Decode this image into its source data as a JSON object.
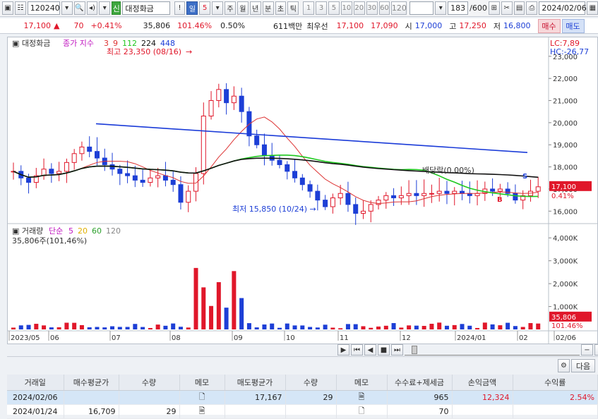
{
  "toolbar": {
    "code": "120240",
    "name_badge": "신",
    "name": "대정화금",
    "bang": "!",
    "period_tabs": [
      "일",
      "5",
      "주",
      "월",
      "년",
      "분",
      "초",
      "틱"
    ],
    "minute_tabs": [
      "1",
      "3",
      "5",
      "10",
      "20",
      "30",
      "60",
      "120"
    ],
    "count": "183",
    "count_total": "/600",
    "date": "2024/02/06"
  },
  "quote": {
    "price": "17,100",
    "change": "70",
    "change_pct": "+0.41%",
    "volume": "35,806",
    "volume_ratio": "101.46%",
    "turnover_rate": "0.50%",
    "amount": "611백만",
    "best_label": "최우선",
    "ask": "17,100",
    "bid": "17,090",
    "open_label": "시",
    "open": "17,000",
    "high_label": "고",
    "high": "17,250",
    "low_label": "저",
    "low": "16,800",
    "buy_btn": "매수",
    "sell_btn": "매도"
  },
  "price_panel": {
    "name": "대정화금",
    "legend_label": "종가 지수",
    "ma": [
      {
        "label": "3",
        "color": "#d33"
      },
      {
        "label": "9",
        "color": "#d33"
      },
      {
        "label": "112",
        "color": "#1fc81f"
      },
      {
        "label": "224",
        "color": "#111"
      },
      {
        "label": "448",
        "color": "#1a3bd8"
      }
    ],
    "lc": "LC:7,89",
    "hc": "HC:-26,77",
    "high_note": "최고 23,350 (08/16)",
    "low_note": "최저 15,850 (10/24)",
    "dividend_note": "배당락(0.00%)",
    "current_tag": "17,100",
    "current_pct": "0.41%",
    "marker_s": "S",
    "marker_b": "B",
    "y_ticks": [
      "23,000",
      "22,000",
      "21,000",
      "20,000",
      "19,000",
      "18,000",
      "17,000",
      "16,000"
    ]
  },
  "volume_panel": {
    "label": "거래량",
    "ma_label": "단순",
    "ma": [
      {
        "label": "5",
        "color": "#c018c0"
      },
      {
        "label": "20",
        "color": "#e0b000"
      },
      {
        "label": "60",
        "color": "#2ca02c"
      },
      {
        "label": "120",
        "color": "#888"
      }
    ],
    "sub": "35,806주(101,46%)",
    "y_ticks": [
      "4,000K",
      "3,000K",
      "2,000K",
      "1,000K"
    ],
    "current_tag": "35,806",
    "current_pct": "101.46%"
  },
  "x_axis": [
    "2023/05",
    "06",
    "07",
    "08",
    "09",
    "10",
    "11",
    "12",
    "2024/01",
    "02",
    "02/06"
  ],
  "table": {
    "headers": [
      "거래일",
      "매수평균가",
      "수량",
      "메모",
      "매도평균가",
      "수량",
      "메모",
      "수수료+제세금",
      "손익금액",
      "수익률"
    ],
    "rows": [
      [
        "2024/02/06",
        "",
        "",
        "",
        "17,167",
        "29",
        "",
        "965",
        "12,324",
        "2.54%"
      ],
      [
        "2024/01/24",
        "16,709",
        "29",
        "",
        "",
        "",
        "",
        "70",
        "",
        ""
      ]
    ],
    "next_btn": "다음"
  },
  "chart_data": {
    "type": "candlestick",
    "x_range": [
      "2023/05",
      "2024/02/06"
    ],
    "price_ylim": [
      15500,
      23600
    ],
    "volume_ylim": [
      0,
      4500000
    ],
    "high": {
      "date": "08/16",
      "value": 23350
    },
    "low": {
      "date": "10/24",
      "value": 15850
    },
    "last": {
      "date": "2024/02/06",
      "close": 17100,
      "volume": 35806
    },
    "ma448_line": {
      "start": 19950,
      "end": 18650
    },
    "closes": [
      17800,
      17500,
      17300,
      17600,
      17900,
      17700,
      17800,
      18200,
      18600,
      18900,
      18700,
      18400,
      18100,
      17900,
      17700,
      17600,
      17400,
      17300,
      17500,
      17600,
      17400,
      17200,
      16400,
      16900,
      17700,
      20300,
      21000,
      21500,
      20900,
      21200,
      20500,
      19400,
      19000,
      18500,
      18300,
      18100,
      17800,
      17500,
      17200,
      16900,
      16500,
      16200,
      16600,
      16800,
      16300,
      15900,
      16000,
      16300,
      16500,
      16700,
      16600,
      16700,
      16800,
      16700,
      16800,
      16800,
      16900,
      16800,
      16900,
      16800,
      16700,
      16800,
      17000,
      16900,
      17000,
      16800,
      16500,
      16700,
      16900,
      17100
    ]
  }
}
